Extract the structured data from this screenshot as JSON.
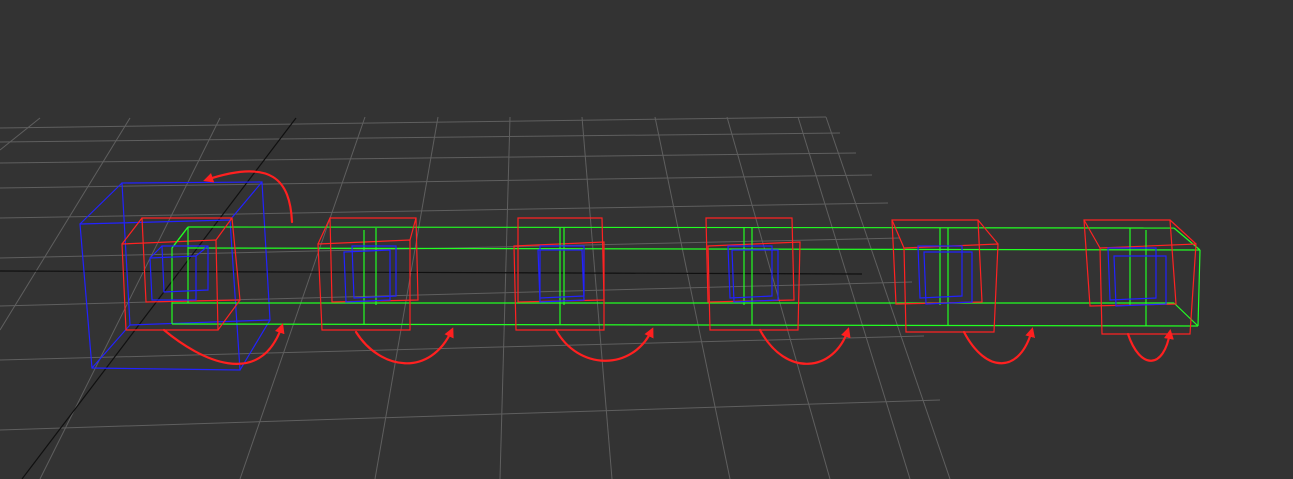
{
  "viewport": {
    "background_color": "#333333",
    "grid_color": "#5f5f5f",
    "axis_color": "#101010"
  },
  "colors": {
    "outer_bounds": "#2222ff",
    "mid_bounds": "#ff2222",
    "chain_bounds": "#22ff22",
    "inner_bounds": "#2222ff",
    "arrow": "#ff2020"
  },
  "chain": {
    "node_count": 6,
    "arrow_count": 6
  }
}
